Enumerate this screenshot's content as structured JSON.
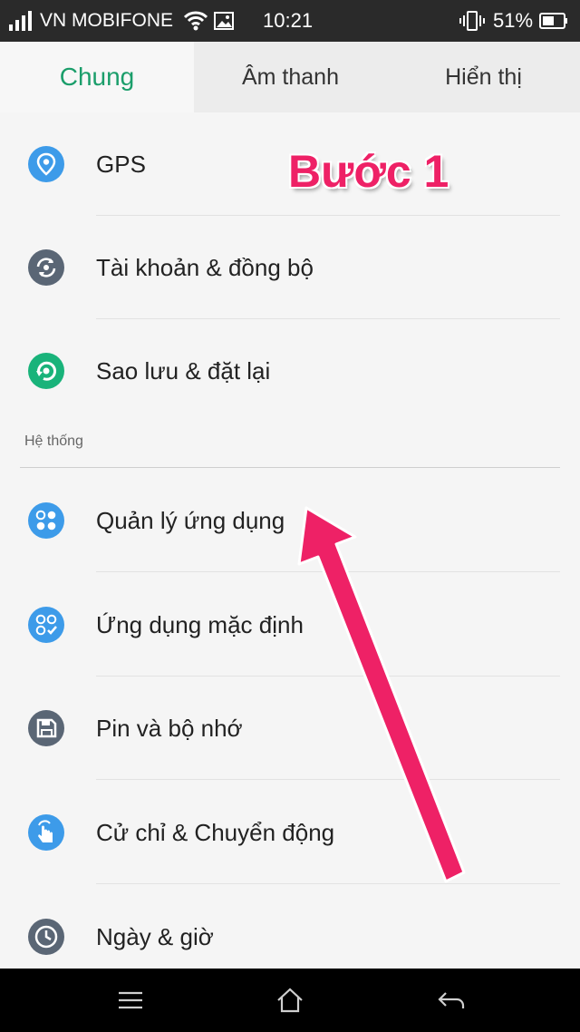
{
  "status_bar": {
    "carrier": "VN MOBIFONE",
    "time": "10:21",
    "battery": "51%",
    "icons": [
      "signal-icon",
      "wifi-icon",
      "image-icon",
      "vibrate-icon",
      "battery-icon"
    ]
  },
  "tabs": [
    {
      "label": "Chung",
      "active": true
    },
    {
      "label": "Âm thanh",
      "active": false
    },
    {
      "label": "Hiển thị",
      "active": false
    }
  ],
  "items_top": [
    {
      "label": "GPS",
      "icon": "location-icon",
      "color": "#3d9be9"
    },
    {
      "label": "Tài khoản & đồng bộ",
      "icon": "sync-icon",
      "color": "#5a6675"
    },
    {
      "label": "Sao lưu & đặt lại",
      "icon": "backup-icon",
      "color": "#19b37a"
    }
  ],
  "section": {
    "label": "Hệ thống"
  },
  "items_system": [
    {
      "label": "Quản lý ứng dụng",
      "icon": "apps-icon",
      "color": "#3d9be9"
    },
    {
      "label": "Ứng dụng mặc định",
      "icon": "default-apps-icon",
      "color": "#3d9be9"
    },
    {
      "label": "Pin và bộ nhớ",
      "icon": "save-icon",
      "color": "#5a6675"
    },
    {
      "label": "Cử chỉ & Chuyển động",
      "icon": "gesture-icon",
      "color": "#3d9be9"
    },
    {
      "label": "Ngày & giờ",
      "icon": "clock-icon",
      "color": "#5a6675"
    }
  ],
  "annotation": {
    "label": "Bước 1",
    "color": "#ee2166"
  },
  "nav_bar": {
    "icons": [
      "menu-icon",
      "home-icon",
      "back-icon"
    ]
  },
  "colors": {
    "accent": "#1b9e6b",
    "status_bar_bg": "#2a2a2a",
    "nav_bar_bg": "#000000"
  }
}
